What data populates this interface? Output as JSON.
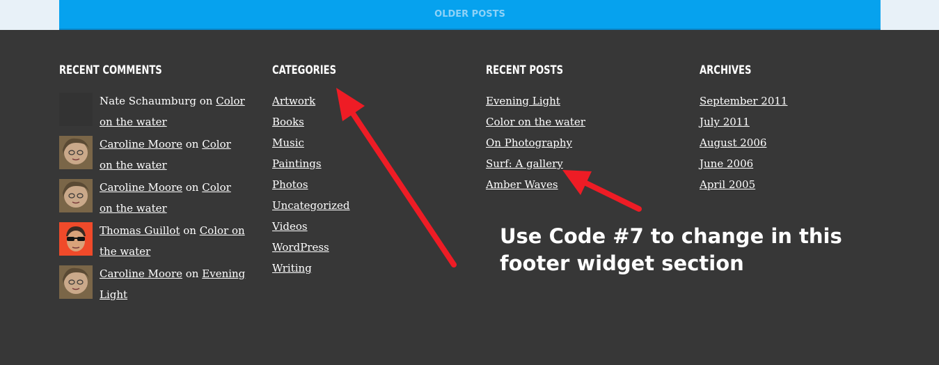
{
  "nav": {
    "older_posts": "OLDER POSTS"
  },
  "recent_comments": {
    "heading": "RECENT COMMENTS",
    "on": "on",
    "items": [
      {
        "author": "Nate Schaumburg",
        "post": "Color on the water",
        "avatar": "blank-avatar"
      },
      {
        "author": "Caroline Moore",
        "post": "Color on the water",
        "avatar": "woman-avatar"
      },
      {
        "author": "Caroline Moore",
        "post": "Color on the water",
        "avatar": "woman-avatar"
      },
      {
        "author": "Thomas Guillot",
        "post": "Color on the water",
        "avatar": "man-sunglasses-avatar"
      },
      {
        "author": "Caroline Moore",
        "post": "Evening Light",
        "avatar": "woman-avatar"
      }
    ]
  },
  "categories": {
    "heading": "CATEGORIES",
    "items": [
      "Artwork",
      "Books",
      "Music",
      "Paintings",
      "Photos",
      "Uncategorized",
      "Videos",
      "WordPress",
      "Writing"
    ]
  },
  "recent_posts": {
    "heading": "RECENT POSTS",
    "items": [
      "Evening Light",
      "Color on the water",
      "On Photography",
      "Surf: A gallery",
      "Amber Waves"
    ]
  },
  "archives": {
    "heading": "ARCHIVES",
    "items": [
      "September 2011",
      "July 2011",
      "August 2006",
      "June 2006",
      "April 2005"
    ]
  },
  "annotation": {
    "text_line1": "Use Code #7 to change in this",
    "text_line2": "footer widget section",
    "arrow_color": "#ee1c25"
  },
  "colors": {
    "footer_bg": "#373737",
    "button_bg": "#06a2ee",
    "top_band": "#e8f1f8"
  }
}
